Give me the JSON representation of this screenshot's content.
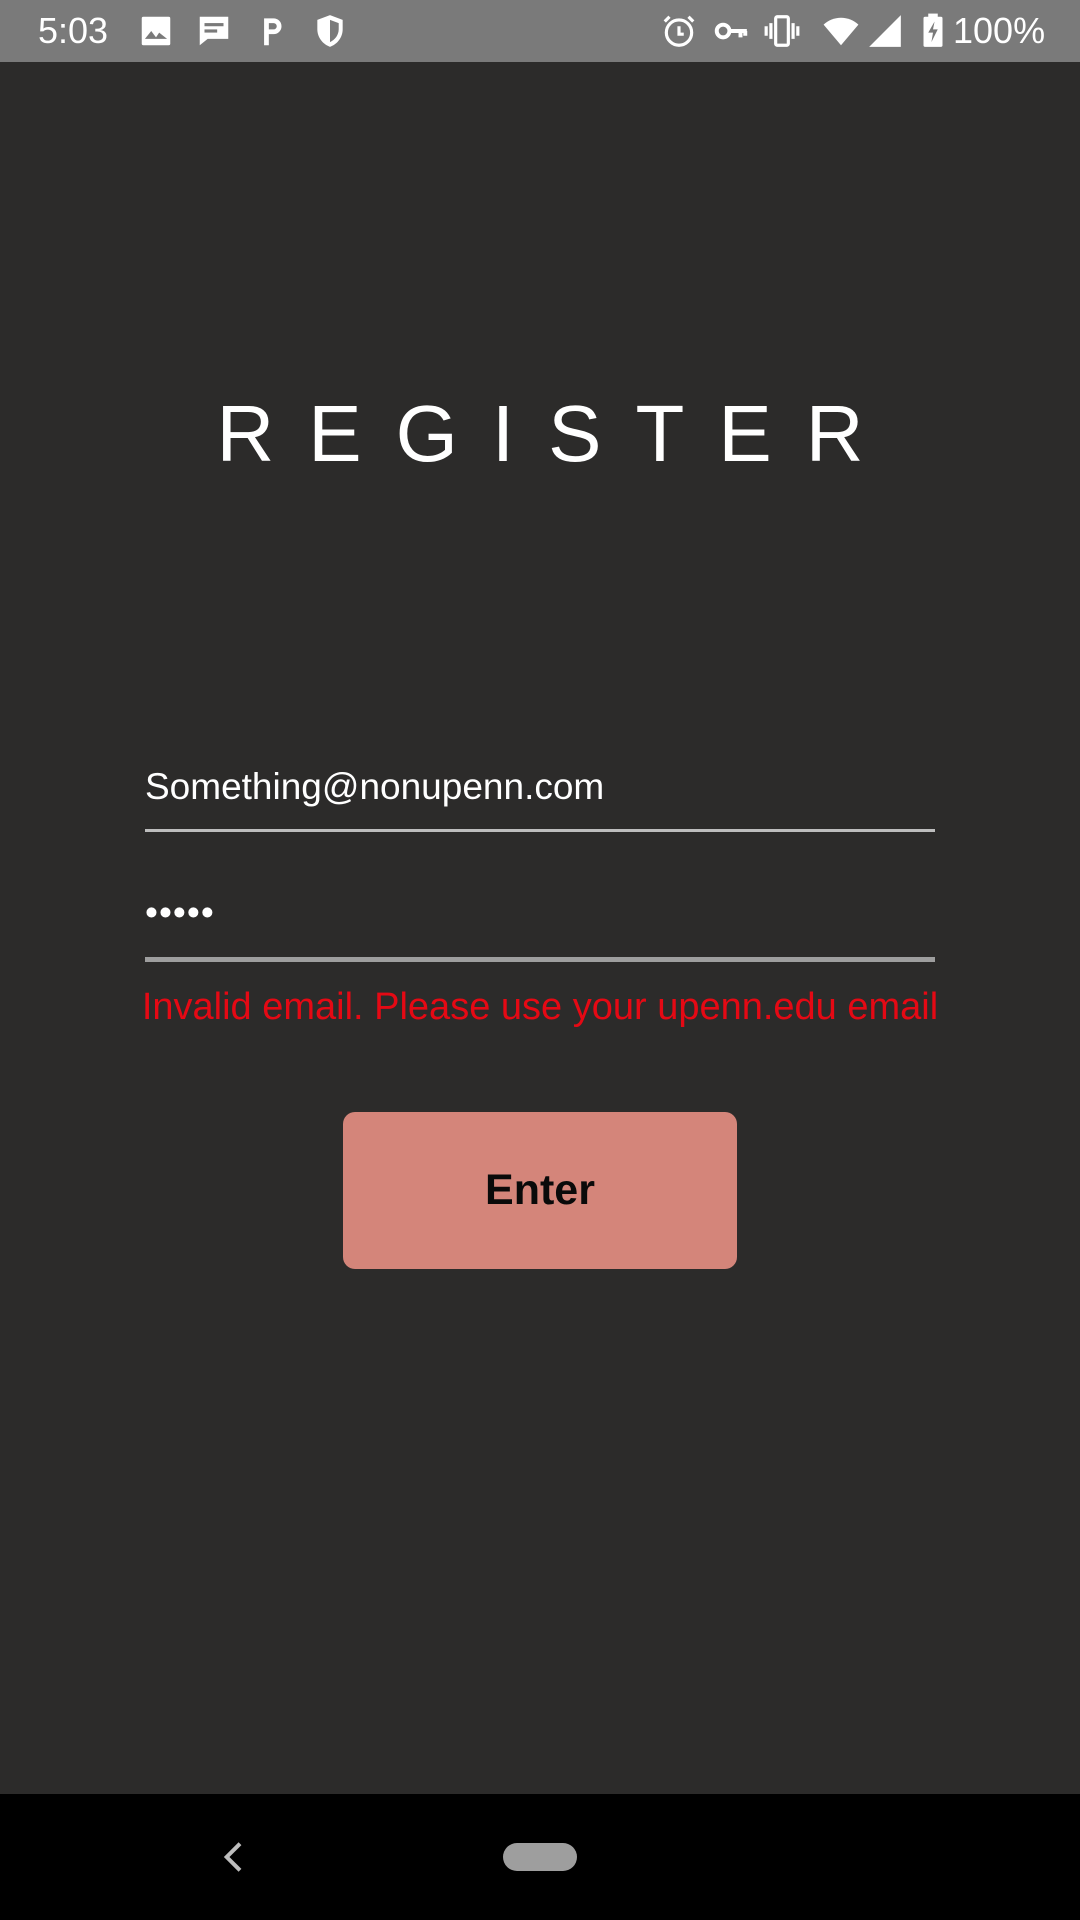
{
  "status_bar": {
    "time": "5:03",
    "battery": "100%",
    "left_icons": [
      "image-icon",
      "message-icon",
      "parking-icon",
      "shield-icon"
    ],
    "right_icons": [
      "alarm-icon",
      "key-icon",
      "vibrate-icon",
      "wifi-icon",
      "signal-icon",
      "battery-charging-icon"
    ]
  },
  "screen": {
    "title": "REGISTER",
    "email": {
      "value": "Something@nonupenn.com"
    },
    "password": {
      "masked_value": "•••••"
    },
    "error": "Invalid email. Please use your upenn.edu email",
    "enter_label": "Enter"
  },
  "colors": {
    "background": "#2c2b2a",
    "status_bar": "#7a7a7a",
    "error": "#e50914",
    "button": "#d4857a",
    "nav_bar": "#000000"
  },
  "nav_bar": {
    "icons": [
      "back-icon",
      "home-pill-icon"
    ]
  }
}
